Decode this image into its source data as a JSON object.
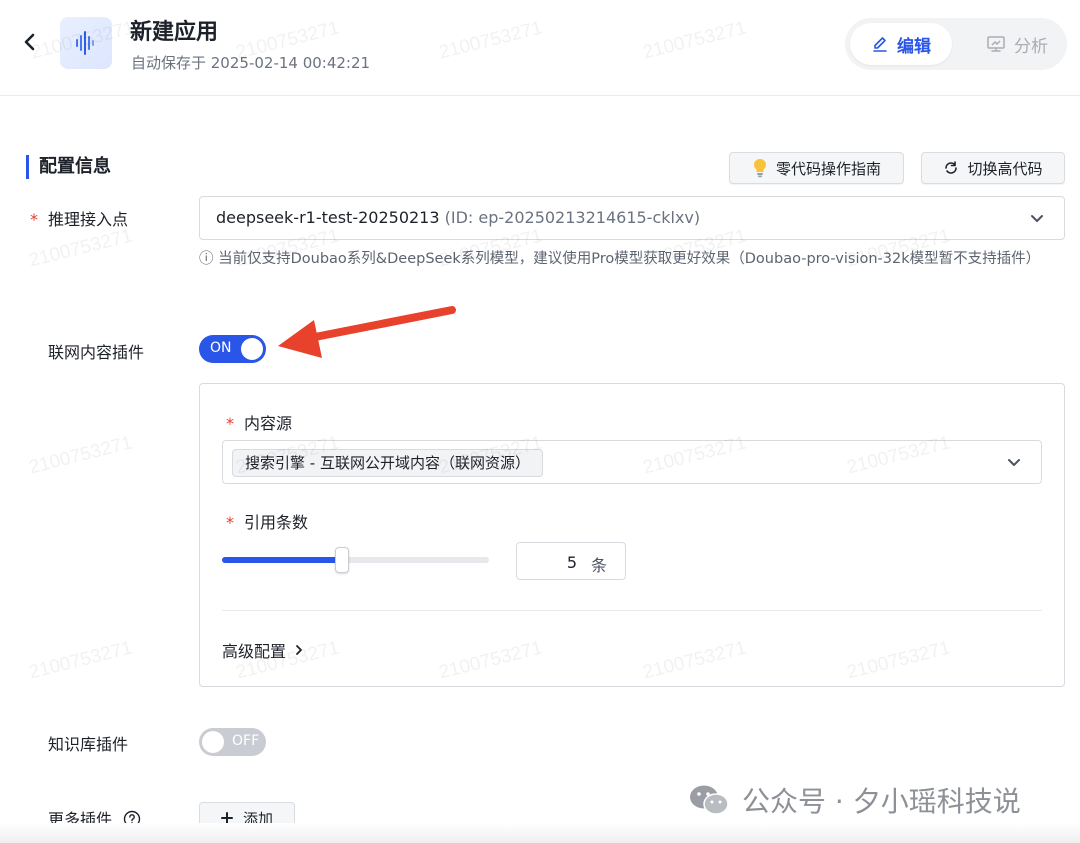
{
  "header": {
    "app_title": "新建应用",
    "autosave": "自动保存于 2025-02-14 00:42:21",
    "tabs": [
      {
        "label": "编辑",
        "active": true,
        "icon": "edit-icon"
      },
      {
        "label": "分析",
        "active": false,
        "icon": "monitor-chart-icon"
      }
    ]
  },
  "section": {
    "title": "配置信息",
    "guide_button": "零代码操作指南",
    "switch_code_button": "切换高代码"
  },
  "endpoint": {
    "label": "推理接入点",
    "value_name": "deepseek-r1-test-20250213",
    "value_id": "(ID: ep-20250213214615-cklxv)",
    "hint": "ⓘ 当前仅支持Doubao系列&DeepSeek系列模型，建议使用Pro模型获取更好效果（Doubao-pro-vision-32k模型暂不支持插件）"
  },
  "web_plugin": {
    "label": "联网内容插件",
    "toggle_text": "ON",
    "enabled": true,
    "content_source": {
      "label": "内容源",
      "selected_tag": "搜索引擎 - 互联网公开域内容（联网资源）"
    },
    "citation_count": {
      "label": "引用条数",
      "value": "5",
      "unit": "条",
      "slider_fraction": 0.45
    },
    "advanced_label": "高级配置"
  },
  "knowledge_plugin": {
    "label": "知识库插件",
    "toggle_text": "OFF",
    "enabled": false
  },
  "more_plugins": {
    "label": "更多插件",
    "add_button": "添加"
  },
  "watermark_text": "2100753271",
  "wechat_mark": "公众号 · 夕小瑶科技说",
  "colors": {
    "accent": "#2955e8",
    "required": "#e33b33",
    "arrow": "#e8412c"
  }
}
